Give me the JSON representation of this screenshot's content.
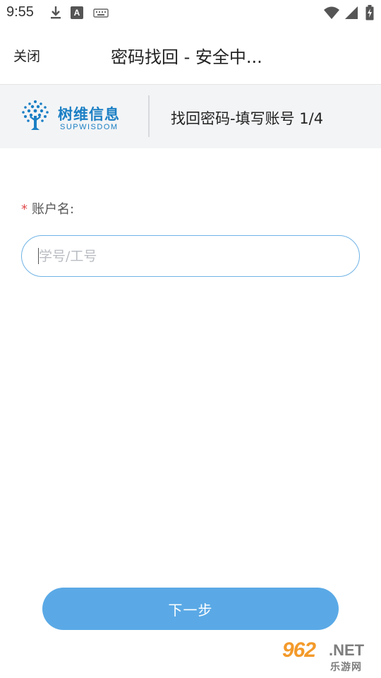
{
  "status_bar": {
    "time": "9:55",
    "icons_left": [
      "download-icon",
      "font-a-icon",
      "keyboard-icon"
    ],
    "icons_right": [
      "wifi-icon",
      "signal-icon",
      "battery-charging-icon"
    ],
    "font_icon_letter": "A"
  },
  "title_bar": {
    "close_label": "关闭",
    "title": "密码找回 - 安全中..."
  },
  "header": {
    "logo_cn": "树维信息",
    "logo_en": "SUPWISDOM",
    "step_title": "找回密码-填写账号 1/4"
  },
  "form": {
    "required_mark": "*",
    "label": "账户名:",
    "placeholder": "学号/工号",
    "value": ""
  },
  "actions": {
    "next_label": "下一步"
  },
  "watermark": {
    "number": "962",
    "suffix": ".NET",
    "cn": "乐游网"
  },
  "colors": {
    "accent": "#5aa9e6",
    "input_border": "#6fb3e6",
    "brand": "#1b7fc4",
    "required": "#e04a4a",
    "header_band": "#f3f4f6"
  }
}
